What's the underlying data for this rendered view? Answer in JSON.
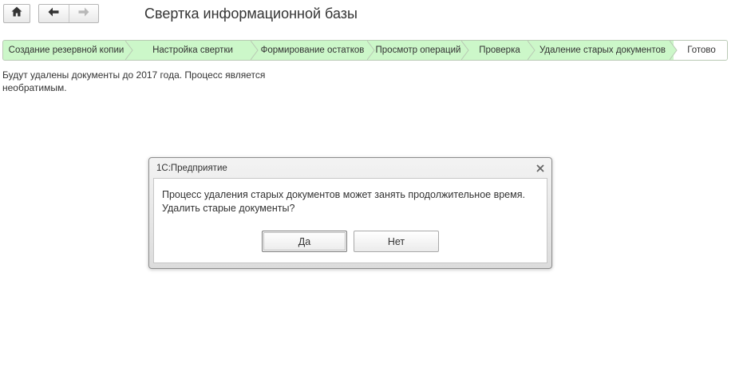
{
  "header": {
    "title": "Свертка информационной базы",
    "home_icon": "home-icon",
    "back_icon": "arrow-left-icon",
    "forward_icon": "arrow-right-icon"
  },
  "steps": {
    "items": [
      {
        "label": "Создание резервной копии",
        "state": "done"
      },
      {
        "label": "Настройка свертки",
        "state": "done"
      },
      {
        "label": "Формирование остатков",
        "state": "done"
      },
      {
        "label": "Просмотр операций",
        "state": "done"
      },
      {
        "label": "Проверка",
        "state": "done"
      },
      {
        "label": "Удаление старых документов",
        "state": "current"
      },
      {
        "label": "Готово",
        "state": "pending"
      }
    ],
    "done_color": "#ccf7c9",
    "pending_color": "#ffffff"
  },
  "main": {
    "info_text": "Будут удалены документы до 2017 года. Процесс является необратимым."
  },
  "dialog": {
    "title": "1С:Предприятие",
    "message": "Процесс удаления старых документов может занять продолжительное время. Удалить старые документы?",
    "yes_label": "Да",
    "no_label": "Нет",
    "close_icon": "close-icon"
  }
}
